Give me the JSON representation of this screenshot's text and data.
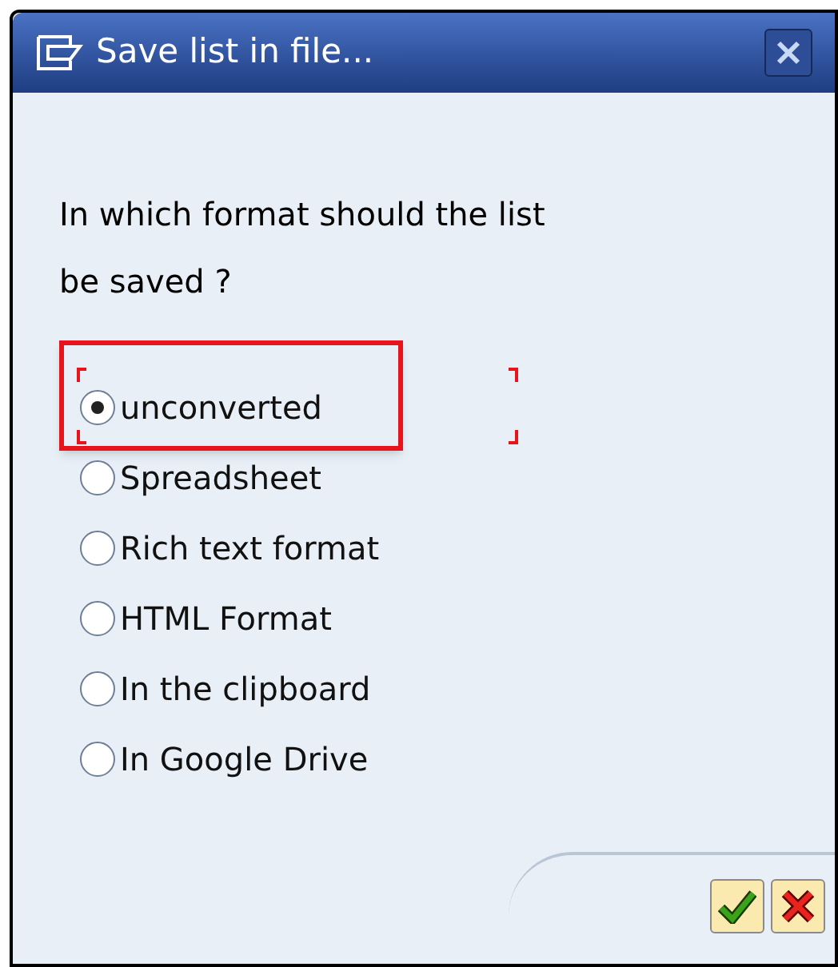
{
  "window": {
    "title": "Save list in file..."
  },
  "question": "In which format should the list be saved ?",
  "options": [
    {
      "label": "unconverted",
      "selected": true,
      "focused": true,
      "highlighted": true
    },
    {
      "label": "Spreadsheet",
      "selected": false,
      "focused": false,
      "highlighted": false
    },
    {
      "label": "Rich text format",
      "selected": false,
      "focused": false,
      "highlighted": false
    },
    {
      "label": "HTML Format",
      "selected": false,
      "focused": false,
      "highlighted": false
    },
    {
      "label": "In the clipboard",
      "selected": false,
      "focused": false,
      "highlighted": false
    },
    {
      "label": "In Google Drive",
      "selected": false,
      "focused": false,
      "highlighted": false
    }
  ]
}
